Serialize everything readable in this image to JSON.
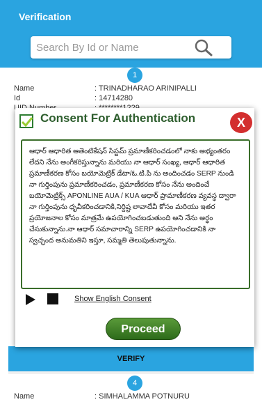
{
  "appbar": {
    "title": "Verification",
    "search_placeholder": "Search By Id or Name"
  },
  "cards": [
    {
      "badge": "1",
      "fields": [
        {
          "label": "Name",
          "value": ": TRINADHARAO ARINIPALLI"
        },
        {
          "label": "Id",
          "value": ": 14714280"
        },
        {
          "label": "UID Number",
          "value": ": ********1229"
        }
      ]
    },
    {
      "badge": "4",
      "fields": [
        {
          "label": "Name",
          "value": ": SIMHALAMMA POTNURU"
        }
      ]
    }
  ],
  "verify_label": "VERIFY",
  "dialog": {
    "title": "Consent For Authentication",
    "close_label": "X",
    "consent_text": "ఆధార్ ఆధారిత ఆతెంటికేషన్ సిస్టమ్ ప్రమాణీకరించడంలో నాకు అభ్యంతరం లేదని నేను అంగీకరిస్తున్నాను మరియు నా ఆధార్ సంఖ్య, ఆధార్ ఆధారిత ప్రమాణీకరణ కోసం బయోమెట్రిక్ డేటా/ఓ.టి.పి ను అందించడం SERP నుండి నా గుర్తింపును ప్రమాణీకరించడం, ప్రమాణీకరణ కోసం నేను అందించే బయోమెట్రిక్స్ APONLINE AUA / KUA ఆధార్ ప్రామాణీకరణ వ్యవస్థ ద్వారా నా గుర్తింపును ధృవీకరించడానికి,నిర్దిష్ట లావాదేవీ కోసం మరియు ఇతర ప్రయోజనాల కోసం మాత్రమే ఉపయోగించబడుతుంది అని నేను అర్థం చేసుకున్నాను.నా ఆధార్ సమాచారాన్ని SERP ఉపయోగించడానికి నా స్వచ్ఛంద అనుమతిని ఇస్తూ, సమ్మతి తెలుపుతున్నాను.",
    "english_link": "Show English Consent",
    "proceed_label": "Proceed"
  },
  "colors": {
    "accent": "#2aa4e0",
    "consent_border": "#3a6e2a",
    "close": "#d32f2f",
    "proceed": "#3d7d25"
  }
}
